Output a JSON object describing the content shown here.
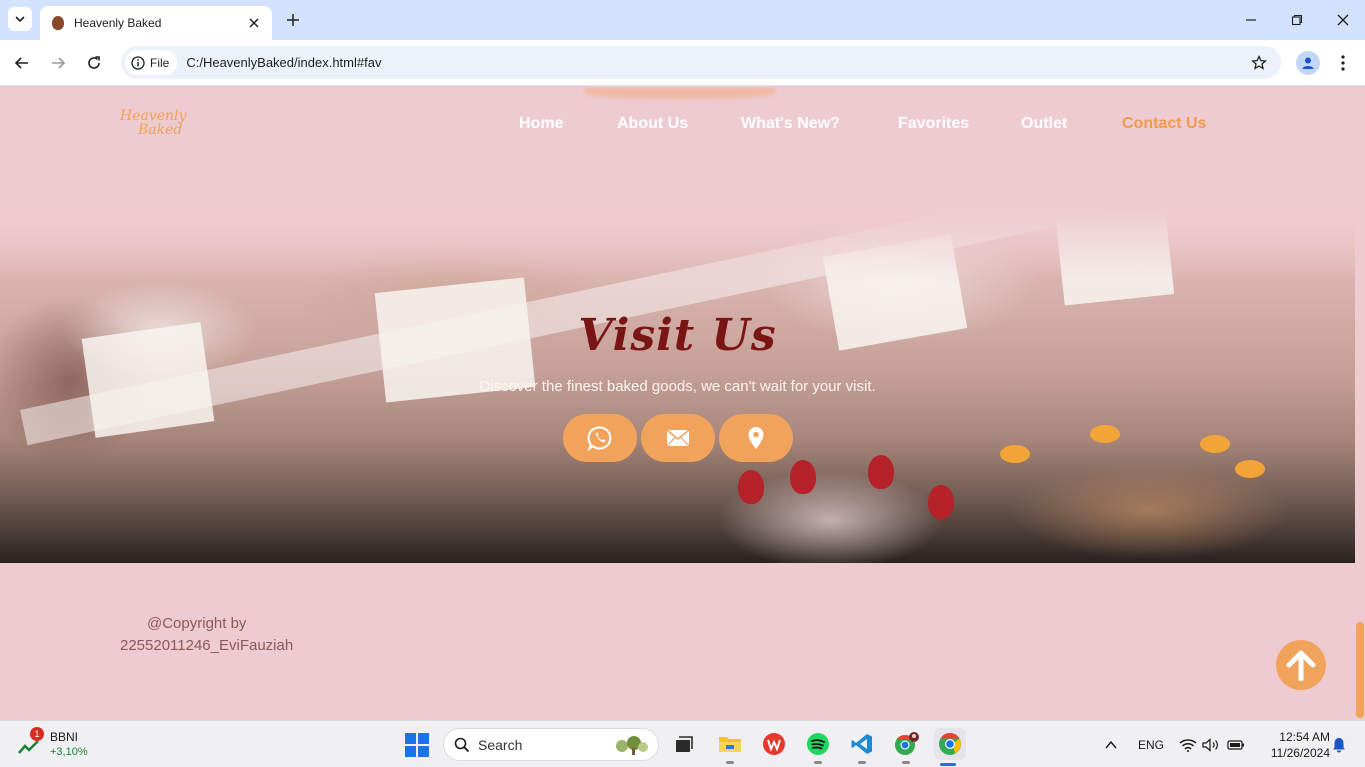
{
  "browser": {
    "tab_title": "Heavenly Baked",
    "site_chip_label": "File",
    "url": "C:/HeavenlyBaked/index.html#fav"
  },
  "site": {
    "logo_line1": "Heavenly",
    "logo_line2": "Baked",
    "nav": {
      "home": "Home",
      "about": "About Us",
      "whats_new": "What's New?",
      "favorites": "Favorites",
      "outlet": "Outlet",
      "contact": "Contact Us"
    },
    "active_nav": "Contact Us",
    "hero": {
      "title": "Visit Us",
      "subtitle": "Discover the finest baked goods, we can't wait for your visit.",
      "buttons": [
        "whatsapp-icon",
        "mail-icon",
        "location-pin-icon"
      ]
    },
    "footer": {
      "copyright_line1": "@Copyright by",
      "copyright_line2": "22552011246_EviFauziah"
    },
    "colors": {
      "background": "#eecbd0",
      "accent": "#f2a35b",
      "title": "#7a1515"
    }
  },
  "taskbar": {
    "stock_badge": "1",
    "stock_name": "BBNI",
    "stock_change": "+3,10%",
    "search_placeholder": "Search",
    "language": "ENG",
    "time": "12:54 AM",
    "date": "11/26/2024"
  }
}
